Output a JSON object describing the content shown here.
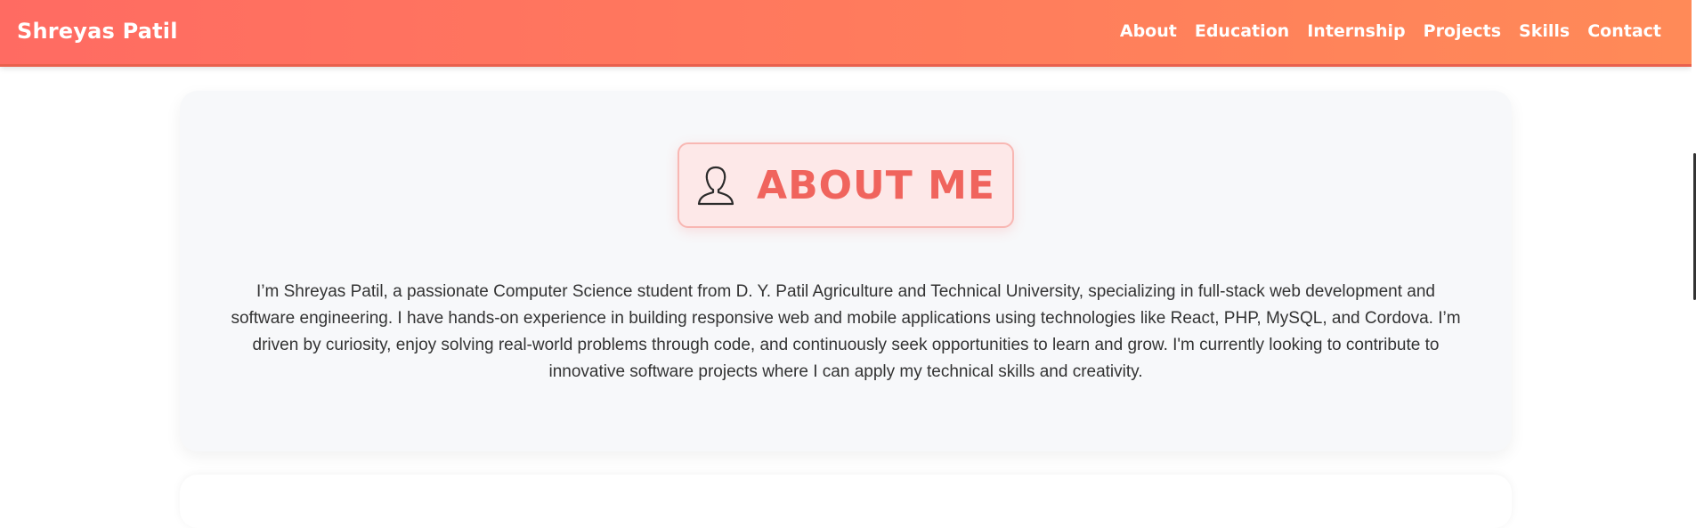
{
  "header": {
    "brand": "Shreyas Patil",
    "nav": [
      {
        "label": "About"
      },
      {
        "label": "Education"
      },
      {
        "label": "Internship"
      },
      {
        "label": "Projects"
      },
      {
        "label": "Skills"
      },
      {
        "label": "Contact"
      }
    ]
  },
  "about": {
    "icon": "user-icon",
    "title": "ABOUT ME",
    "text": "I’m Shreyas Patil, a passionate Computer Science student from D. Y. Patil Agriculture and Technical University, specializing in full-stack web development and software engineering. I have hands-on experience in building responsive web and mobile applications using technologies like React, PHP, MySQL, and Cordova. I’m driven by curiosity, enjoy solving real-world problems through code, and continuously seek opportunities to learn and grow. I'm currently looking to contribute to innovative software projects where I can apply my technical skills and creativity."
  },
  "colors": {
    "header_gradient_start": "#ff6b62",
    "header_gradient_end": "#ff8a58",
    "accent": "#f0645d",
    "heading_box_bg": "#fde8e8",
    "card_bg": "#f7f8fa"
  }
}
